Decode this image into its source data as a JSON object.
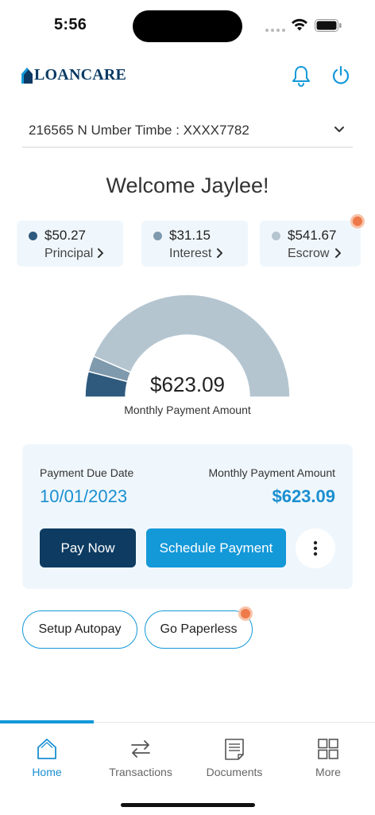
{
  "status": {
    "time": "5:56"
  },
  "header": {
    "logo_text": "LOANCARE"
  },
  "account": {
    "label": "216565 N Umber Timbe : XXXX7782"
  },
  "welcome": "Welcome Jaylee!",
  "breakdown": [
    {
      "amount": "$50.27",
      "label": "Principal",
      "color": "#2f5a7e"
    },
    {
      "amount": "$31.15",
      "label": "Interest",
      "color": "#7f99ad"
    },
    {
      "amount": "$541.67",
      "label": "Escrow",
      "color": "#b4c5d0"
    }
  ],
  "gauge": {
    "amount": "$623.09",
    "label": "Monthly Payment Amount",
    "segments": [
      {
        "name": "Principal",
        "value": 50.27,
        "color": "#2f5a7e"
      },
      {
        "name": "Interest",
        "value": 31.15,
        "color": "#7f99ad"
      },
      {
        "name": "Escrow",
        "value": 541.67,
        "color": "#b4c5d0"
      }
    ]
  },
  "payment": {
    "due_label": "Payment Due Date",
    "due_value": "10/01/2023",
    "amount_label": "Monthly Payment Amount",
    "amount_value": "$623.09",
    "pay_now": "Pay Now",
    "schedule": "Schedule Payment"
  },
  "actions": {
    "autopay": "Setup Autopay",
    "paperless": "Go Paperless"
  },
  "tabs": [
    {
      "label": "Home",
      "icon": "home-icon",
      "active": true
    },
    {
      "label": "Transactions",
      "icon": "transactions-icon",
      "active": false
    },
    {
      "label": "Documents",
      "icon": "documents-icon",
      "active": false
    },
    {
      "label": "More",
      "icon": "grid-icon",
      "active": false
    }
  ],
  "colors": {
    "accent": "#1398d8",
    "navy": "#0d3b61",
    "notification": "#ee7a4a"
  }
}
